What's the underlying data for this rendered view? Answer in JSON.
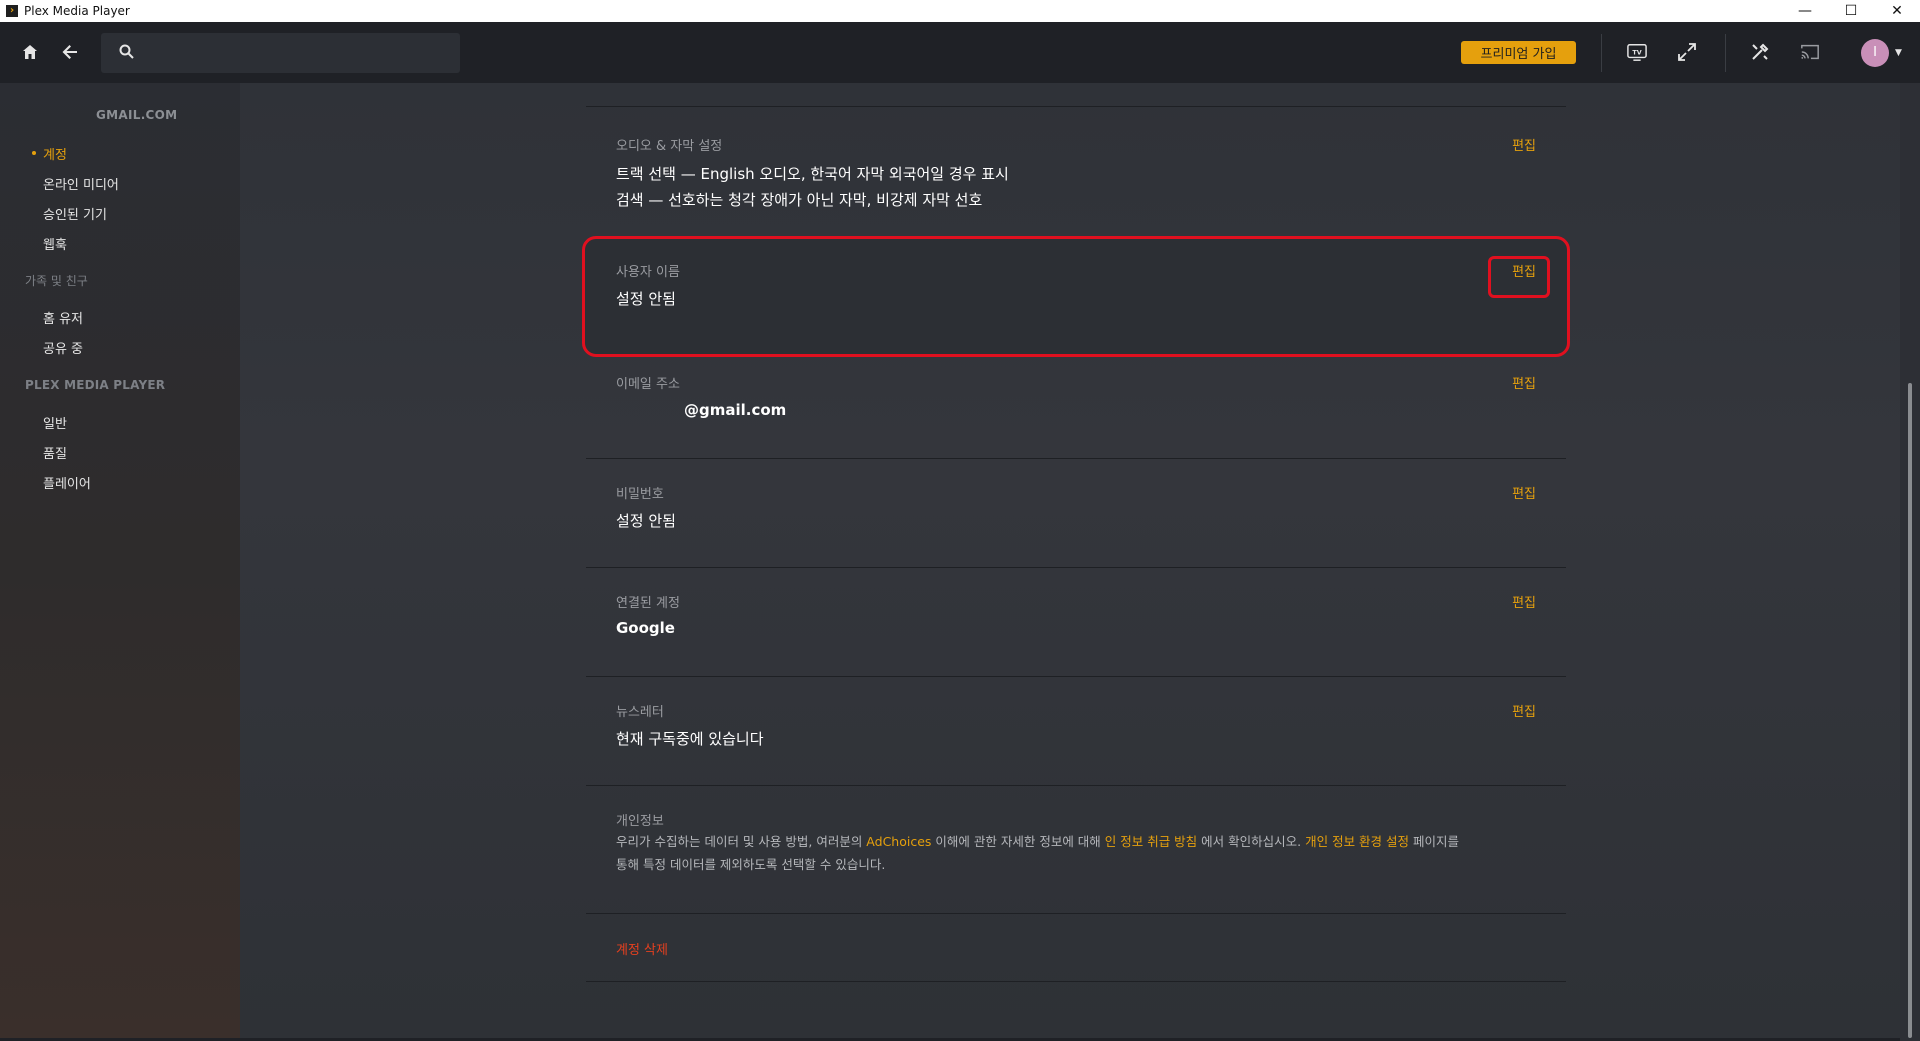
{
  "window": {
    "title": "Plex Media Player",
    "minimize": "—",
    "maximize": "☐",
    "close": "✕"
  },
  "topbar": {
    "search_placeholder": "",
    "premium_label": "프리미엄 가입",
    "tv_label": "TV",
    "avatar_letter": "I"
  },
  "sidebar": {
    "account_email": "GMAIL.COM",
    "account_items": [
      {
        "label": "계정",
        "active": true
      },
      {
        "label": "온라인 미디어"
      },
      {
        "label": "승인된 기기"
      },
      {
        "label": "웹훅"
      }
    ],
    "family_section": "가족 및 친구",
    "family_items": [
      {
        "label": "홈 유저"
      },
      {
        "label": "공유 중"
      }
    ],
    "player_section": "PLEX MEDIA PLAYER",
    "player_items": [
      {
        "label": "일반"
      },
      {
        "label": "품질"
      },
      {
        "label": "플레이어"
      }
    ]
  },
  "main": {
    "audio": {
      "label": "오디오 & 자막 설정",
      "line1": "트랙 선택 — English 오디오, 한국어 자막 외국어일 경우 표시",
      "line2": "검색 — 선호하는 청각 장애가 아닌 자막, 비강제 자막 선호",
      "edit": "편집"
    },
    "username": {
      "label": "사용자 이름",
      "value": "설정 안됨",
      "edit": "편집"
    },
    "email": {
      "label": "이메일 주소",
      "value": "@gmail.com",
      "edit": "편집"
    },
    "password": {
      "label": "비밀번호",
      "value": "설정 안됨",
      "edit": "편집"
    },
    "linked": {
      "label": "연결된 계정",
      "value": "Google",
      "edit": "편집"
    },
    "newsletter": {
      "label": "뉴스레터",
      "value": "현재 구독중에 있습니다",
      "edit": "편집"
    },
    "privacy": {
      "label": "개인정보",
      "t1": "우리가 수집하는 데이터 및 사용 방법, 여러분의 ",
      "link1": "AdChoices",
      "t2": " 이해에 관한 자세한 정보에 대해 ",
      "link2": "인 정보 취급 방침",
      "t3": " 에서 확인하십시오. ",
      "link3": "개인 정보 환경 설정",
      "t4": " 페이지를",
      "line2": "통해 특정 데이터를 제외하도록 선택할 수 있습니다."
    },
    "delete_account": "계정 삭제"
  },
  "colors": {
    "accent": "#e5a00d",
    "highlight": "#e0101f",
    "danger": "#e5401f"
  }
}
